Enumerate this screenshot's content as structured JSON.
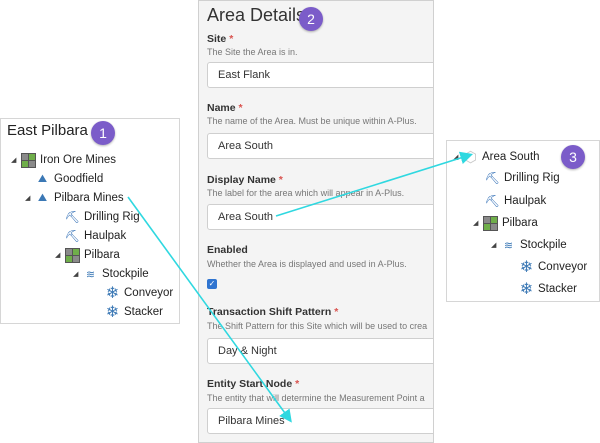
{
  "left_panel": {
    "title": "East Pilbara",
    "badge": "1",
    "tree": [
      {
        "label": "Iron Ore Mines",
        "icon": "grid-icon"
      },
      {
        "label": "Goodfield",
        "icon": "stockpile-location-icon"
      },
      {
        "label": "Pilbara Mines",
        "icon": "stockpile-location-icon"
      },
      {
        "label": "Drilling Rig",
        "icon": "drill-icon"
      },
      {
        "label": "Haulpak",
        "icon": "drill-icon"
      },
      {
        "label": "Pilbara",
        "icon": "grid-icon"
      },
      {
        "label": "Stockpile",
        "icon": "stockpile-icon"
      },
      {
        "label": "Conveyor",
        "icon": "snowflake-icon"
      },
      {
        "label": "Stacker",
        "icon": "snowflake-icon"
      }
    ]
  },
  "form": {
    "title": "Area Details",
    "badge": "2",
    "site": {
      "label": "Site",
      "required": "*",
      "help": "The Site the Area is in.",
      "value": "East Flank"
    },
    "name": {
      "label": "Name",
      "required": "*",
      "help": "The name of the Area. Must be unique within A-Plus.",
      "value": "Area South"
    },
    "display_name": {
      "label": "Display Name",
      "required": "*",
      "help": "The label for the area which will appear in A-Plus.",
      "value": "Area South"
    },
    "enabled": {
      "label": "Enabled",
      "help": "Whether the Area is displayed and used in A-Plus.",
      "check": "✓"
    },
    "shift_pattern": {
      "label": "Transaction Shift Pattern",
      "required": "*",
      "help": "The Shift Pattern for this Site which will be used to crea",
      "value": "Day & Night"
    },
    "start_node": {
      "label": "Entity Start Node",
      "required": "*",
      "help": "The entity that will determine the Measurement Point a",
      "value": "Pilbara Mines"
    }
  },
  "right_panel": {
    "badge": "3",
    "tree": [
      {
        "label": "Area South",
        "icon": "hexagon-icon"
      },
      {
        "label": "Drilling Rig",
        "icon": "drill-icon"
      },
      {
        "label": "Haulpak",
        "icon": "drill-icon"
      },
      {
        "label": "Pilbara",
        "icon": "grid-icon"
      },
      {
        "label": "Stockpile",
        "icon": "stockpile-icon"
      },
      {
        "label": "Conveyor",
        "icon": "snowflake-icon"
      },
      {
        "label": "Stacker",
        "icon": "snowflake-icon"
      }
    ]
  },
  "colors": {
    "accent": "#7b5cc9",
    "arrow": "#2fd8e0",
    "required": "#d9534f",
    "checkbox": "#2f74d0"
  }
}
